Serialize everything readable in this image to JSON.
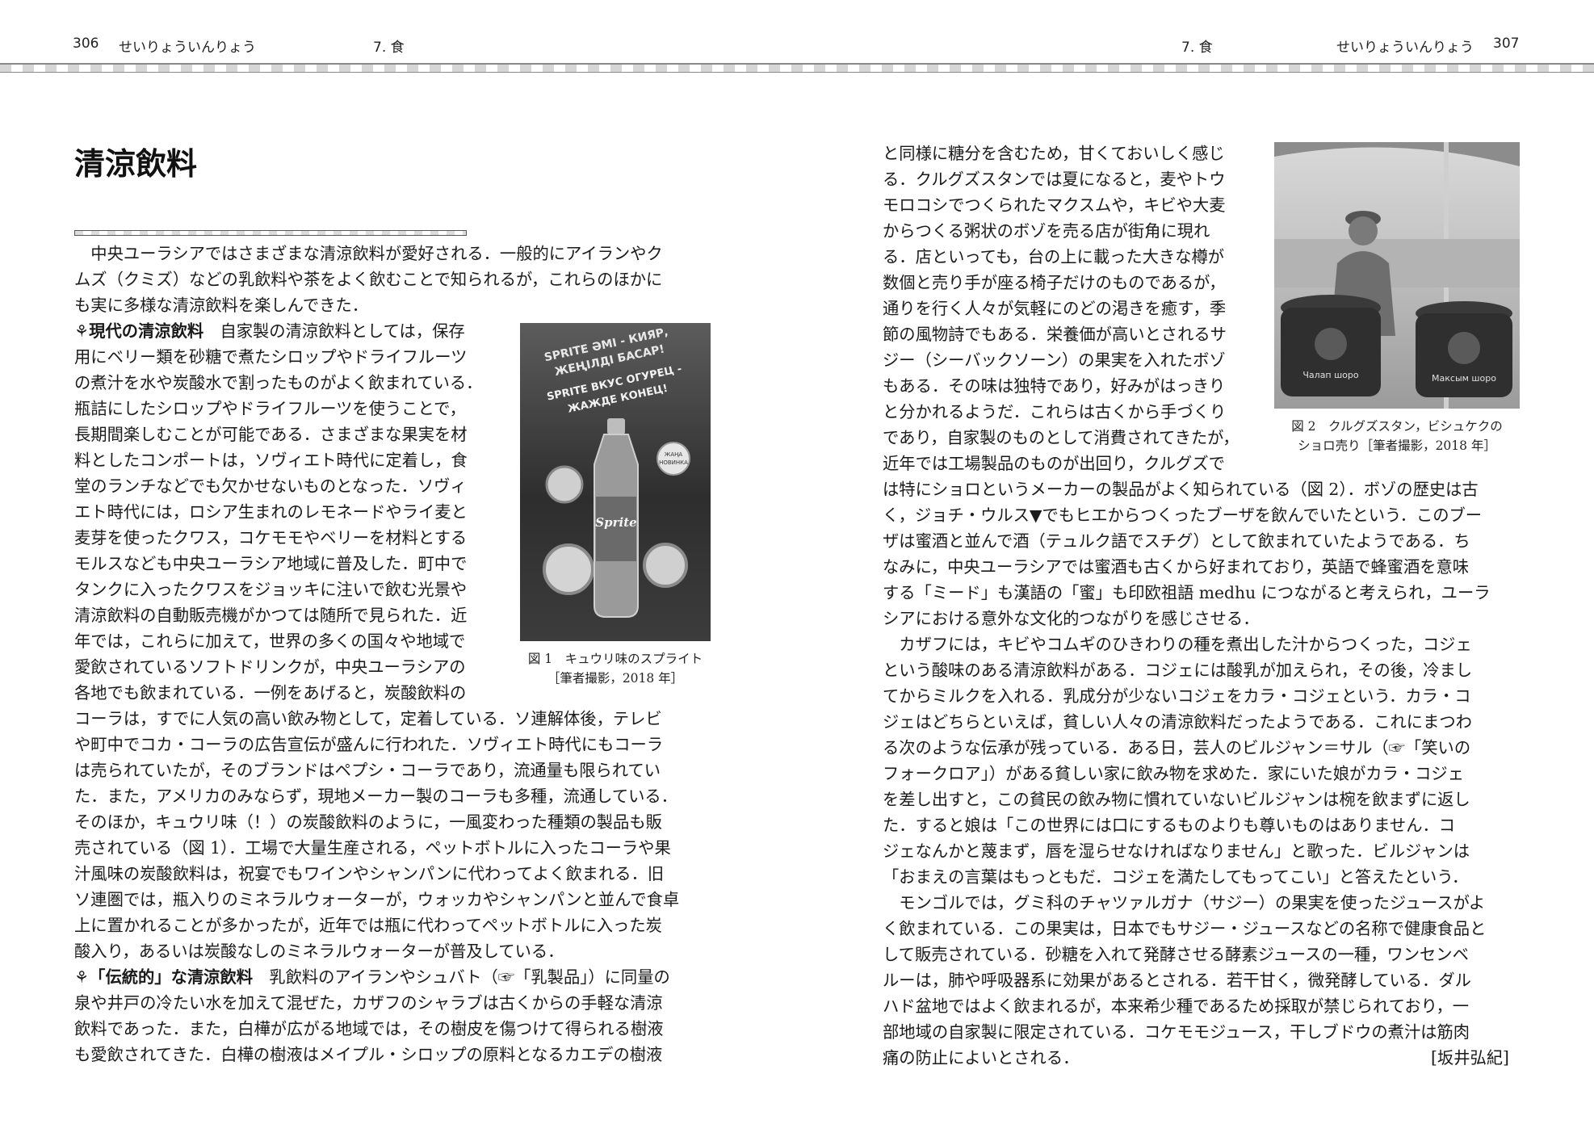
{
  "header": {
    "left_page_number": "306",
    "left_running_title": "せいりょういんりょう",
    "left_chapter": "7. 食",
    "right_chapter": "7. 食",
    "right_running_title": "せいりょういんりょう",
    "right_page_number": "307"
  },
  "article": {
    "title": "清涼飲料",
    "author": "[坂井弘紀]"
  },
  "left_column_full_top": [
    "　中央ユーラシアではさまざまな清涼飲料が愛好される．一般的にアイランやク",
    "ムズ（クミズ）などの乳飲料や茶をよく飲むことで知られるが，これらのほかに",
    "も実に多様な清涼飲料を楽しんできた．"
  ],
  "section1": {
    "mark": "⚘現代の清涼飲料",
    "first_line_rest": "　自家製の清涼飲料としては，保存",
    "narrow_lines": [
      "用にベリー類を砂糖で煮たシロップやドライフルーツ",
      "の煮汁を水や炭酸水で割ったものがよく飲まれている．",
      "瓶詰にしたシロップやドライフルーツを使うことで，",
      "長期間楽しむことが可能である．さまざまな果実を材",
      "料としたコンポートは，ソヴィエト時代に定着し，食",
      "堂のランチなどでも欠かせないものとなった．ソヴィ",
      "エト時代には，ロシア生まれのレモネードやライ麦と",
      "麦芽を使ったクワス，コケモモやベリーを材料とする",
      "モルスなども中央ユーラシア地域に普及した．町中で",
      "タンクに入ったクワスをジョッキに注いで飲む光景や",
      "清涼飲料の自動販売機がかつては随所で見られた．近",
      "年では，これらに加えて，世界の多くの国々や地域で",
      "愛飲されているソフトドリンクが，中央ユーラシアの",
      "各地でも飲まれている．一例をあげると，炭酸飲料の"
    ],
    "full_lines": [
      "コーラは，すでに人気の高い飲み物として，定着している．ソ連解体後，テレビ",
      "や町中でコカ・コーラの広告宣伝が盛んに行われた．ソヴィエト時代にもコーラ",
      "は売られていたが，そのブランドはペプシ・コーラであり，流通量も限られてい",
      "た．また，アメリカのみならず，現地メーカー製のコーラも多種，流通している．",
      "そのほか，キュウリ味（！）の炭酸飲料のように，一風変わった種類の製品も販",
      "売されている（図 1）．工場で大量生産される，ペットボトルに入ったコーラや果",
      "汁風味の炭酸飲料は，祝宴でもワインやシャンパンに代わってよく飲まれる．旧",
      "ソ連圏では，瓶入りのミネラルウォーターが，ウォッカやシャンパンと並んで食卓",
      "上に置かれることが多かったが，近年では瓶に代わってペットボトルに入った炭",
      "酸入り，あるいは炭酸なしのミネラルウォーターが普及している．"
    ]
  },
  "section2": {
    "mark": "⚘「伝統的」な清涼飲料",
    "first_line_rest": "　乳飲料のアイランやシュバト（☞「乳製品」）に同量の",
    "full_lines": [
      "泉や井戸の冷たい水を加えて混ぜた，カザフのシャラブは古くからの手軽な清涼",
      "飲料であった．また，白樺が広がる地域では，その樹皮を傷つけて得られる樹液",
      "も愛飲されてきた．白樺の樹液はメイプル・シロップの原料となるカエデの樹液"
    ]
  },
  "right_column": {
    "narrow_lines": [
      "と同様に糖分を含むため，甘くておいしく感じ",
      "る．クルグズスタンでは夏になると，麦やトウ",
      "モロコシでつくられたマクスムや，キビや大麦",
      "からつくる粥状のボゾを売る店が街角に現れ",
      "る．店といっても，台の上に載った大きな樽が",
      "数個と売り手が座る椅子だけのものであるが，",
      "通りを行く人々が気軽にのどの渇きを癒す，季",
      "節の風物詩でもある．栄養価が高いとされるサ",
      "ジー（シーバックソーン）の果実を入れたボゾ",
      "もある．その味は独特であり，好みがはっきり",
      "と分かれるようだ．これらは古くから手づくり",
      "であり，自家製のものとして消費されてきたが，",
      "近年では工場製品のものが出回り，クルグズで"
    ],
    "full_lines": [
      "は特にショロというメーカーの製品がよく知られている（図 2）．ボゾの歴史は古",
      "く，ジョチ・ウルス▼でもヒエからつくったブーザを飲んでいたという．このブー",
      "ザは蜜酒と並んで酒（テュルク語でスチグ）として飲まれていたようである．ち",
      "なみに，中央ユーラシアでは蜜酒も古くから好まれており，英語で蜂蜜酒を意味",
      "する「ミード」も漢語の「蜜」も印欧祖語 medhu につながると考えられ，ユーラ",
      "シアにおける意外な文化的つながりを感じさせる．",
      "　カザフには，キビやコムギのひきわりの種を煮出した汁からつくった，コジェ",
      "という酸味のある清涼飲料がある．コジェには酸乳が加えられ，その後，冷まし",
      "てからミルクを入れる．乳成分が少ないコジェをカラ・コジェという．カラ・コ",
      "ジェはどちらといえば，貧しい人々の清涼飲料だったようである．これにまつわ",
      "る次のような伝承が残っている．ある日，芸人のビルジャン＝サル（☞「笑いの",
      "フォークロア」）がある貧しい家に飲み物を求めた．家にいた娘がカラ・コジェ",
      "を差し出すと，この貧民の飲み物に慣れていないビルジャンは椀を飲まずに返し",
      "た．すると娘は「この世界には口にするものよりも尊いものはありません．コ",
      "ジェなんかと蔑まず，唇を湿らせなければなりません」と歌った．ビルジャンは",
      "「おまえの言葉はもっともだ．コジェを満たしてもってこい」と答えたという．",
      "　モンゴルでは，グミ科のチャツァルガナ（サジー）の果実を使ったジュースがよ",
      "く飲まれている．この果実は，日本でもサジー・ジュースなどの名称で健康食品と",
      "して販売されている．砂糖を入れて発酵させる酵素ジュースの一種，ワンセンベ",
      "ルーは，肺や呼吸器系に効果があるとされる．若干甘く，微発酵している．ダル",
      "ハド盆地ではよく飲まれるが，本来希少種であるため採取が禁じられており，一",
      "部地域の自家製に限定されている．コケモモジュース，干しブドウの煮汁は筋肉",
      "痛の防止によいとされる．"
    ]
  },
  "figure1": {
    "caption_line1": "図 1　キュウリ味のスプライト",
    "caption_line2": "［筆者撮影，2018 年］",
    "poster_line1": "SPRITE ƏMI - КИЯР,",
    "poster_line2": "ЖЕҢІЛДІ БАСАР!",
    "poster_line3": "SPRITE ВКУС ОГУРЕЦ -",
    "poster_line4": "ЖАЖДЕ КОНЕЦ!",
    "bottle_label": "Sprite",
    "badge_line1": "ЖАҢА",
    "badge_line2": "НОВИНКА"
  },
  "figure2": {
    "caption_line1": "図 2　クルグズスタン，ビシュケクの",
    "caption_line2": "ショロ売り［筆者撮影，2018 年］",
    "barrel_left_label": "Чалап шоро",
    "barrel_right_label": "Максым шоро"
  }
}
